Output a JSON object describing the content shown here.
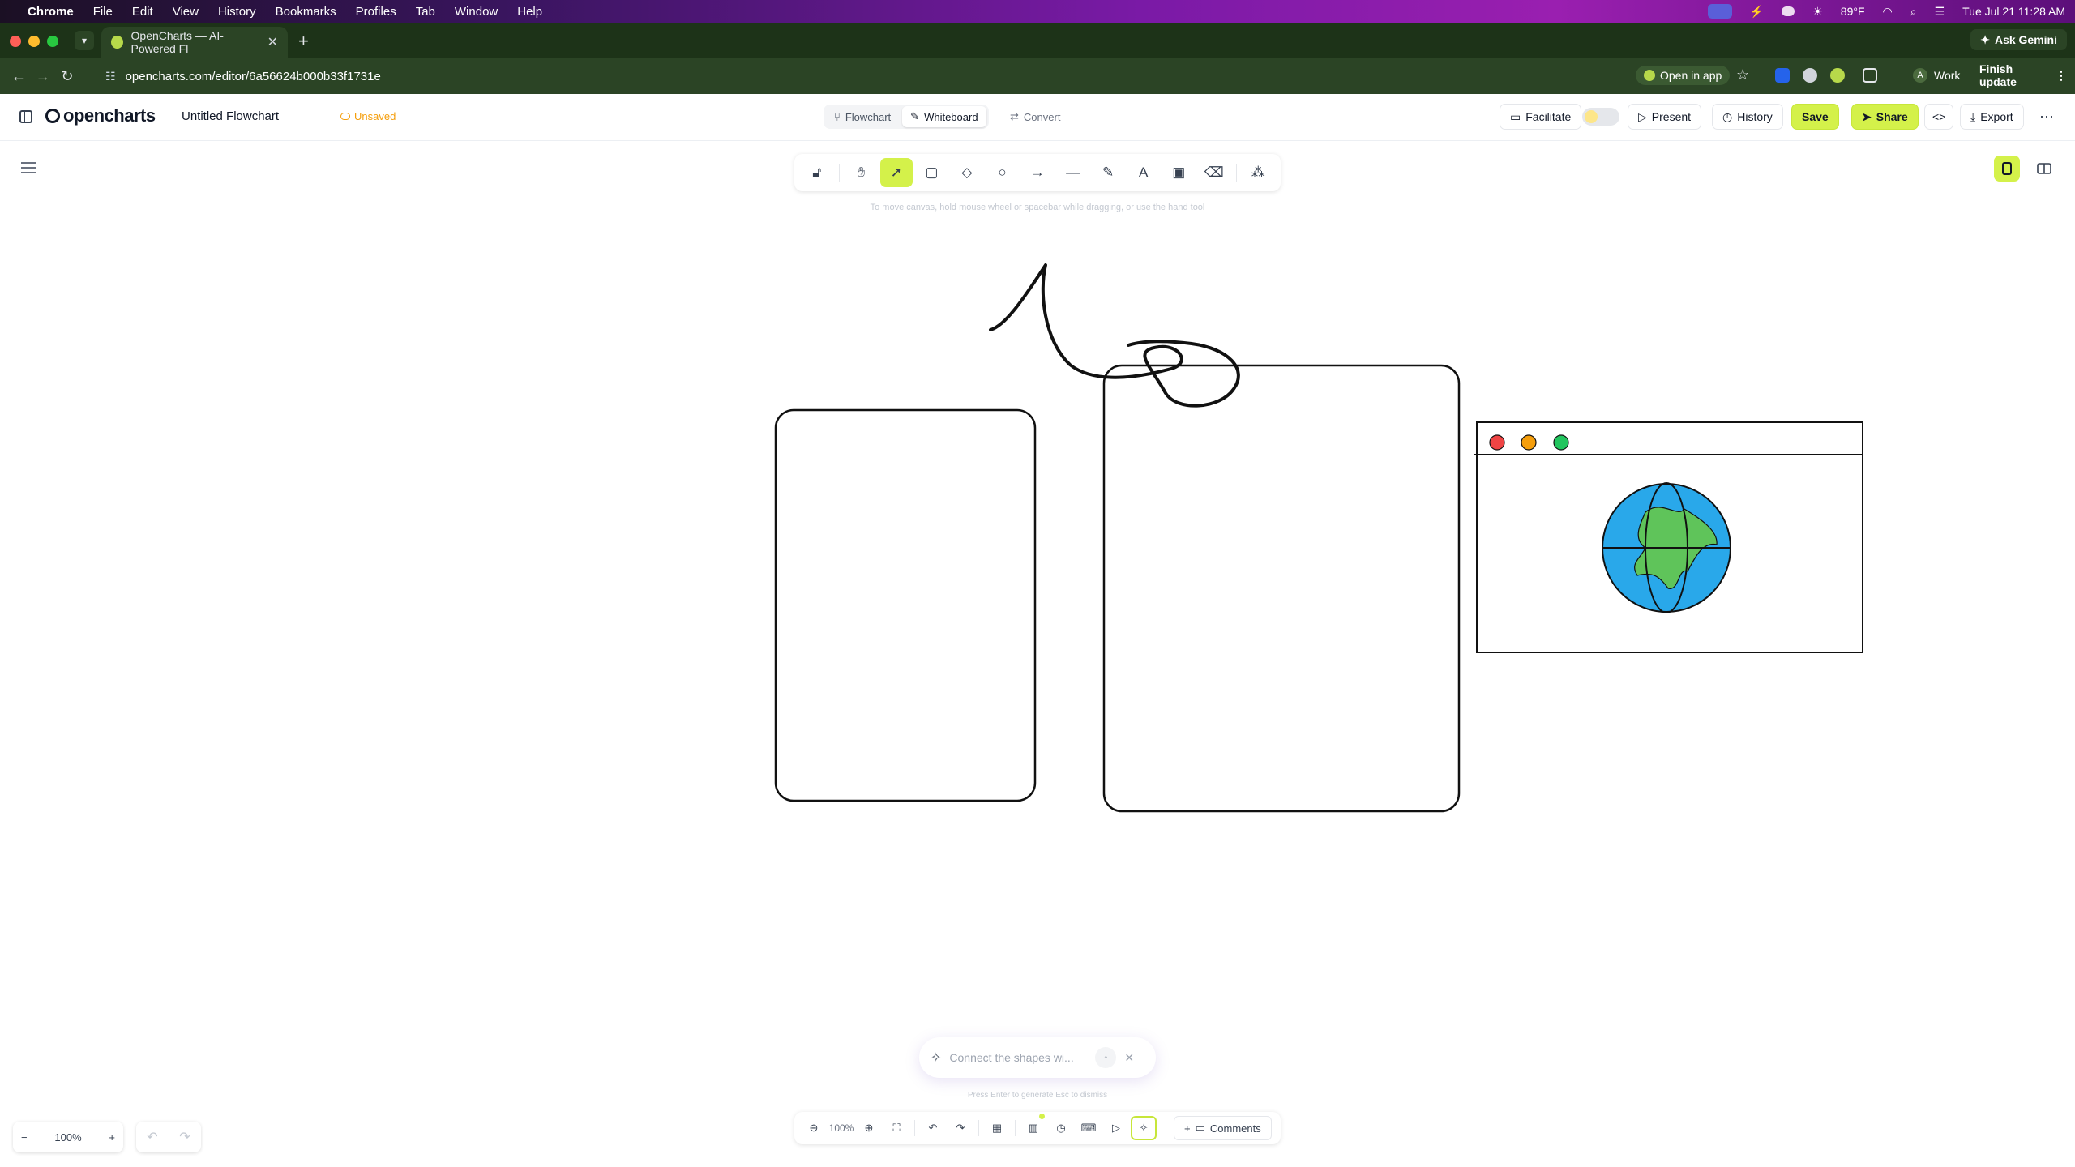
{
  "menubar": {
    "app": "Chrome",
    "items": [
      "File",
      "Edit",
      "View",
      "History",
      "Bookmarks",
      "Profiles",
      "Tab",
      "Window",
      "Help"
    ],
    "weather": "89°F",
    "datetime": "Tue Jul 21  11:28 AM"
  },
  "browser": {
    "tab_title": "OpenCharts — AI-Powered Fl",
    "url": "opencharts.com/editor/6a56624b000b33f1731e",
    "open_in_app": "Open in app",
    "profile_initial": "A",
    "profile_name": "Work",
    "finish_update": "Finish update",
    "ask_gemini": "Ask Gemini"
  },
  "header": {
    "logo": "opencharts",
    "doc_title": "Untitled Flowchart",
    "save_status": "Unsaved",
    "modes": [
      "Flowchart",
      "Whiteboard"
    ],
    "active_mode": "Whiteboard",
    "convert": "Convert",
    "facilitate": "Facilitate",
    "present": "Present",
    "history": "History",
    "save": "Save",
    "share": "Share",
    "export": "Export"
  },
  "canvas": {
    "toolbar_hint": "To move canvas, hold mouse wheel or spacebar while dragging, or use the hand tool",
    "active_tool": "select",
    "browser_window_dots": [
      "#ef4444",
      "#f59e0b",
      "#22c55e"
    ],
    "globe_colors": {
      "ocean": "#29a8ea",
      "land": "#5fc45a"
    }
  },
  "ai_prompt": {
    "placeholder": "Connect the shapes wi...",
    "hint": "Press  Enter  to generate    Esc  to dismiss"
  },
  "bottom": {
    "zoom_label": "100%",
    "toolbar_zoom": "100%",
    "comments": "Comments"
  },
  "colors": {
    "accent": "#d4f14a",
    "unsaved": "#f59e0b"
  }
}
